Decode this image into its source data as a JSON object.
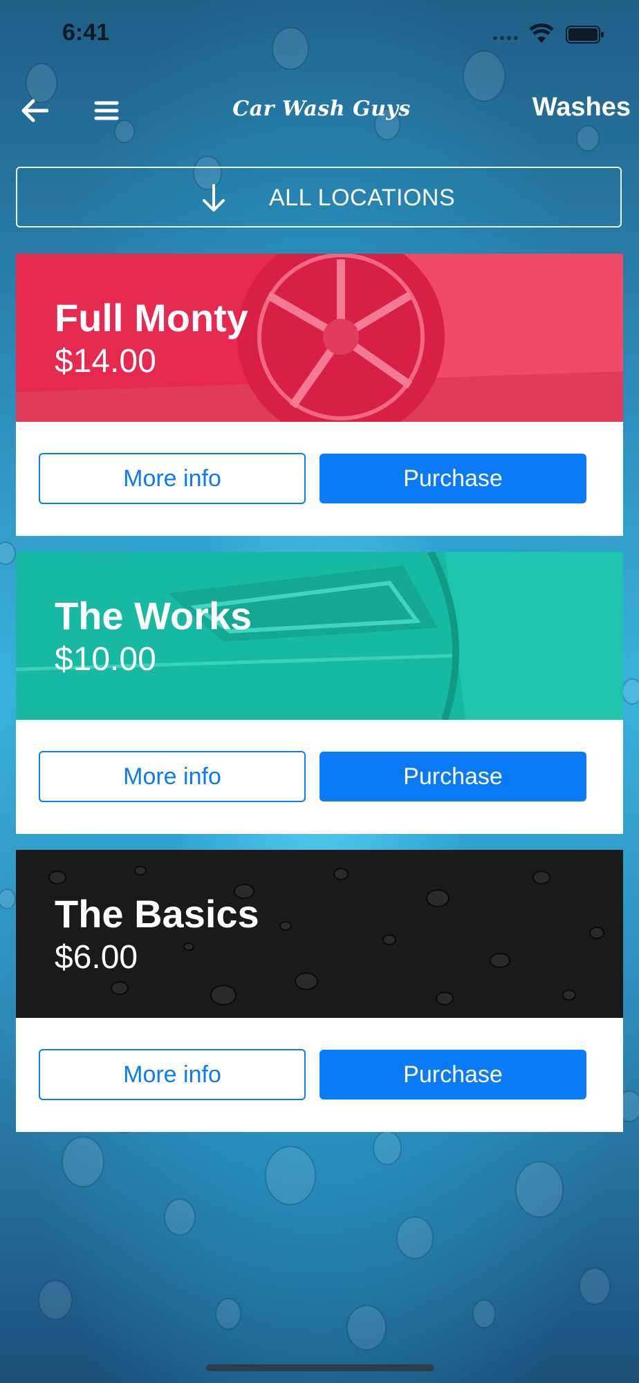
{
  "status_bar": {
    "time": "6:41"
  },
  "nav": {
    "logo_text": "Car Wash Guys",
    "title": "Washes"
  },
  "location_selector": {
    "label": "ALL LOCATIONS"
  },
  "washes": [
    {
      "name": "Full Monty",
      "price": "$14.00",
      "more_info_label": "More info",
      "purchase_label": "Purchase",
      "banner_color": "#e8294f"
    },
    {
      "name": "The Works",
      "price": "$10.00",
      "more_info_label": "More info",
      "purchase_label": "Purchase",
      "banner_color": "#1fc4ad"
    },
    {
      "name": "The Basics",
      "price": "$6.00",
      "more_info_label": "More info",
      "purchase_label": "Purchase",
      "banner_color": "#1a1a1a"
    }
  ],
  "colors": {
    "accent": "#0a7af5",
    "text_light": "#ffffff"
  }
}
